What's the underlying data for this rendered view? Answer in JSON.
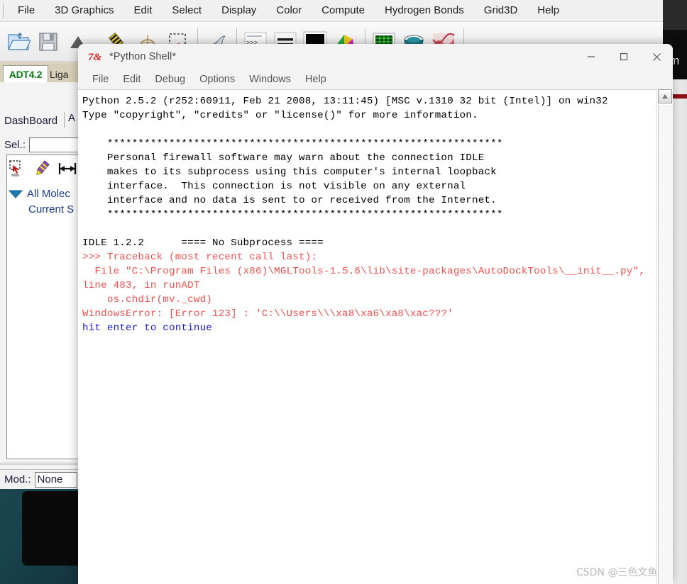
{
  "app": {
    "name": "AutoDockTools (ADT)",
    "menu": [
      "File",
      "3D Graphics",
      "Edit",
      "Select",
      "Display",
      "Color",
      "Compute",
      "Hydrogen Bonds",
      "Grid3D",
      "Help"
    ],
    "toolbar_icons": [
      "open-folder-icon",
      "save-disk-icon",
      "triangle-up-icon",
      "pencil-ruler-icon",
      "protractor-icon",
      "selection-marquee-icon",
      "dolphin-icon",
      "script-lines-icon",
      "equals-lines-icon",
      "black-screen-icon",
      "color-cube-icon",
      "green-grid-icon",
      "teal-bowl-icon",
      "red-surface-icon"
    ],
    "tabs": {
      "active_label": "ADT4.2",
      "second_label": "Liga"
    },
    "panel": {
      "dashboard_label": "DashBoard",
      "dashboard_next_label": "A",
      "selection_label": "Sel.:",
      "selection_value": "",
      "icons": [
        "select-drag-icon",
        "crayon-icon",
        "measure-distance-icon"
      ],
      "tree": [
        {
          "label": "All Molec",
          "has_arrow": true
        },
        {
          "label": "Current S",
          "has_arrow": false
        }
      ],
      "mod_label": "Mod.:",
      "mod_value": "None"
    }
  },
  "shell": {
    "title": "*Python Shell*",
    "icon": "idle-python-icon",
    "menu": [
      "File",
      "Edit",
      "Debug",
      "Options",
      "Windows",
      "Help"
    ],
    "window_controls": {
      "minimize": "minimize-icon",
      "maximize": "maximize-icon",
      "close": "close-icon"
    },
    "output_lines": [
      {
        "color": "black",
        "text": "Python 2.5.2 (r252:60911, Feb 21 2008, 13:11:45) [MSC v.1310 32 bit (Intel)] on win32"
      },
      {
        "color": "black",
        "text": "Type \"copyright\", \"credits\" or \"license()\" for more information."
      },
      {
        "color": "black",
        "text": ""
      },
      {
        "color": "black",
        "text": "    ****************************************************************"
      },
      {
        "color": "black",
        "text": "    Personal firewall software may warn about the connection IDLE"
      },
      {
        "color": "black",
        "text": "    makes to its subprocess using this computer's internal loopback"
      },
      {
        "color": "black",
        "text": "    interface.  This connection is not visible on any external"
      },
      {
        "color": "black",
        "text": "    interface and no data is sent to or received from the Internet."
      },
      {
        "color": "black",
        "text": "    ****************************************************************"
      },
      {
        "color": "black",
        "text": ""
      },
      {
        "color": "black",
        "text": "IDLE 1.2.2      ==== No Subprocess ===="
      },
      {
        "color": "red",
        "text": ">>> Traceback (most recent call last):"
      },
      {
        "color": "red",
        "text": "  File \"C:\\Program Files (x86)\\MGLTools-1.5.6\\lib\\site-packages\\AutoDockTools\\__init__.py\", line 483, in runADT"
      },
      {
        "color": "red",
        "text": "    os.chdir(mv._cwd)"
      },
      {
        "color": "red",
        "text": "WindowsError: [Error 123] : 'C:\\\\Users\\\\\\xa8\\xa6\\xa8\\xac???'"
      },
      {
        "color": "blue",
        "text": "hit enter to continue"
      }
    ],
    "scrollbar": {
      "up_arrow": "scroll-up-arrow-icon"
    }
  },
  "desktop": {
    "partial_text": "am"
  },
  "watermark": {
    "text": "CSDN @三色文鱼"
  },
  "colors": {
    "traceback_red": "#f0514e",
    "prompt_blue": "#1c19d6",
    "tab_green": "#0a7a16",
    "desktop_teal": "#18424c",
    "accent_red_line": "#8c1015"
  }
}
